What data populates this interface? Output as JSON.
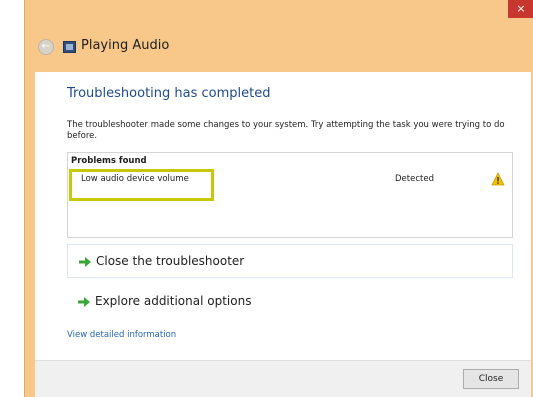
{
  "window": {
    "title": "Playing Audio",
    "close_glyph": "×"
  },
  "icons": {
    "back": "back-arrow-icon",
    "title": "troubleshooter-icon",
    "warning": "warning-icon",
    "action_arrow": "green-arrow-icon"
  },
  "content": {
    "heading": "Troubleshooting has completed",
    "description": "The troubleshooter made some changes to your system. Try attempting the task you were trying to do before.",
    "problems": {
      "header": "Problems found",
      "items": [
        {
          "name": "Low audio device volume",
          "status": "Detected"
        }
      ]
    },
    "actions": [
      {
        "label": "Close the troubleshooter"
      },
      {
        "label": "Explore additional options"
      }
    ],
    "detail_link": "View detailed information"
  },
  "footer": {
    "close_label": "Close"
  },
  "colors": {
    "title_bar": "#f7c88a",
    "close_x": "#c7372f",
    "heading": "#1e4a8c",
    "link": "#2566b8",
    "highlight": "#c8c80a",
    "arrow": "#3aa63a",
    "warning": "#f2c200"
  }
}
